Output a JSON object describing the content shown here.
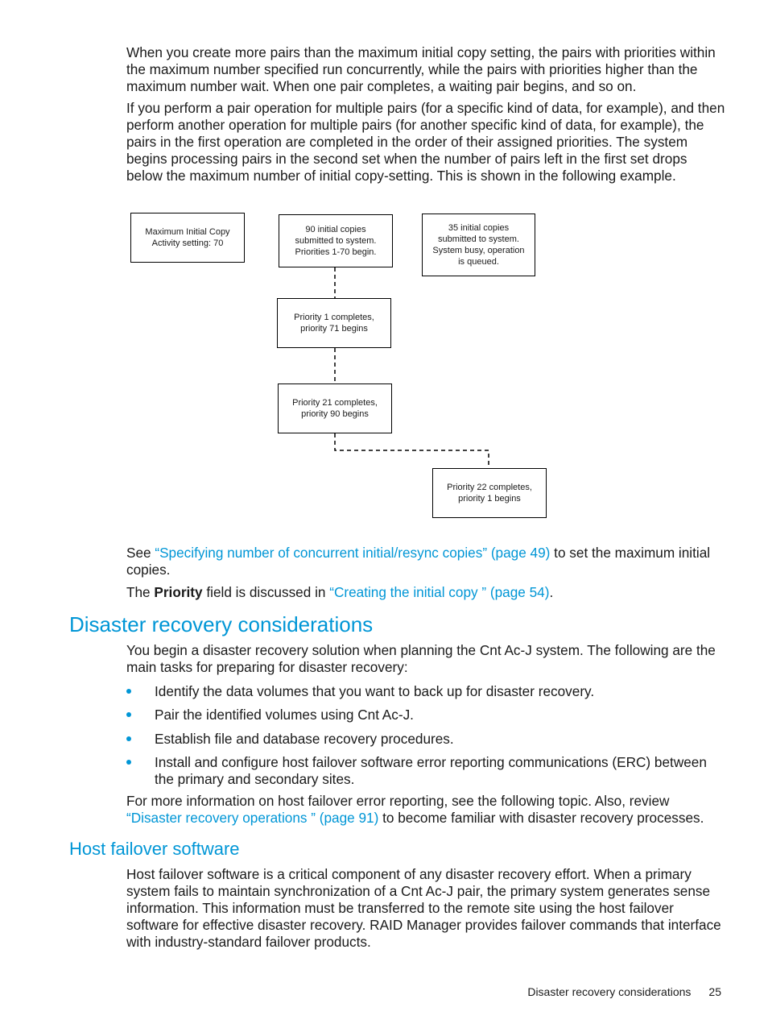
{
  "paragraphs": {
    "p1": "When you create more pairs than the maximum initial copy setting, the pairs with priorities within the maximum number specified run concurrently, while the pairs with priorities higher than the maximum number wait. When one pair completes, a waiting pair begins, and so on.",
    "p2": "If you perform a pair operation for multiple pairs (for a specific kind of data, for example), and then perform another operation for multiple pairs (for another specific kind of data, for example), the pairs in the first operation are completed in the order of their assigned priorities. The system begins processing pairs in the second set when the number of pairs left in the first set drops below the maximum number of initial copy-setting. This is shown in the following example."
  },
  "diagram": {
    "boxes": [
      {
        "id": "max-setting",
        "text": "Maximum Initial Copy\nActivity setting: 70"
      },
      {
        "id": "ninety-copies",
        "text": "90 initial copies\nsubmitted to system.\nPriorities 1-70 begin."
      },
      {
        "id": "thirtyfive-copies",
        "text": "35 initial copies\nsubmitted to system.\nSystem busy, operation\nis queued."
      },
      {
        "id": "priority1",
        "text": "Priority 1 completes,\npriority 71 begins"
      },
      {
        "id": "priority21",
        "text": "Priority 21 completes,\npriority 90 begins"
      },
      {
        "id": "priority22",
        "text": "Priority 22 completes,\npriority 1 begins"
      }
    ]
  },
  "see_para": {
    "prefix": "See ",
    "link": "“Specifying number of concurrent initial/resync copies” (page 49)",
    "suffix": " to set the maximum initial copies."
  },
  "priority_para": {
    "prefix": "The ",
    "bold": "Priority",
    "middle": " field is discussed in ",
    "link": "“Creating the initial copy ” (page 54)",
    "suffix": "."
  },
  "section1": {
    "heading": "Disaster recovery considerations",
    "intro": "You begin a disaster recovery solution when planning the Cnt Ac-J system. The following are the main tasks for preparing for disaster recovery:",
    "bullets": [
      "Identify the data volumes that you want to back up for disaster recovery.",
      "Pair the identified volumes using Cnt Ac-J.",
      "Establish file and database recovery procedures.",
      "Install and configure host failover software error reporting communications (ERC) between the primary and secondary sites."
    ],
    "more_prefix": "For more information on host failover error reporting, see the following topic. Also, review ",
    "more_link": "“Disaster recovery operations ” (page 91)",
    "more_suffix": " to become familiar with disaster recovery processes."
  },
  "section2": {
    "heading": "Host failover software",
    "body": "Host failover software is a critical component of any disaster recovery effort. When a primary system fails to maintain synchronization of a Cnt Ac-J pair, the primary system generates sense information. This information must be transferred to the remote site using the host failover software for effective disaster recovery. RAID Manager provides failover commands that interface with industry-standard failover products."
  },
  "footer": {
    "section": "Disaster recovery considerations",
    "page": "25"
  }
}
